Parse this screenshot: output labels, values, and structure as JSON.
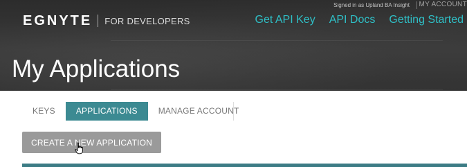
{
  "header": {
    "logo_text": "EGNYTE",
    "logo_subtitle": "FOR DEVELOPERS",
    "signed_in_text": "Signed in as Upland BA Insight",
    "my_account": "MY ACCOUNT",
    "nav": [
      {
        "label": "Get API Key"
      },
      {
        "label": "API Docs"
      },
      {
        "label": "Getting Started"
      }
    ]
  },
  "page": {
    "title": "My Applications"
  },
  "tabs": [
    {
      "label": "KEYS",
      "active": false
    },
    {
      "label": "APPLICATIONS",
      "active": true
    },
    {
      "label": "MANAGE ACCOUNT",
      "active": false
    }
  ],
  "actions": {
    "create_label": "CREATE A NEW APPLICATION"
  },
  "colors": {
    "accent": "#2fbfc6",
    "active_tab": "#3c8a92",
    "button": "#9a9a9a"
  }
}
